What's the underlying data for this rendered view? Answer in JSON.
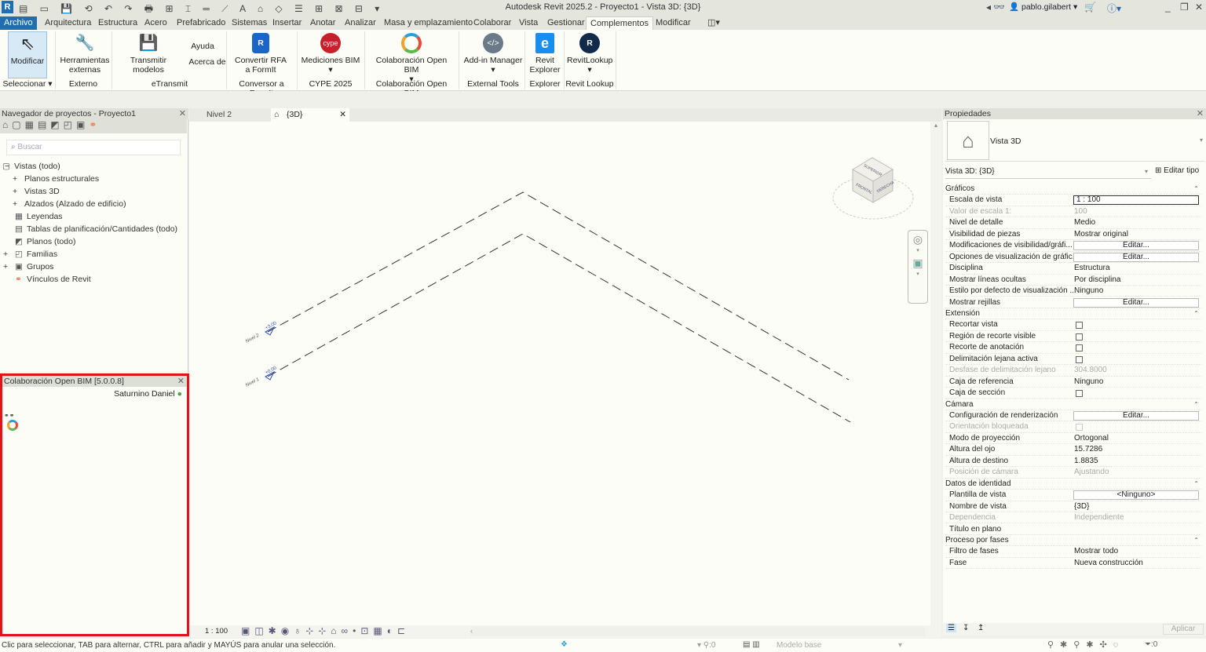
{
  "app": {
    "title": "Autodesk Revit 2025.2 - Proyecto1 - Vista 3D: {3D}",
    "user": "pablo.gilabert"
  },
  "colors": {
    "accent": "#1f6eb3",
    "highlight_border": "#e3131b",
    "ribbon_bg": "#fdfdf7"
  },
  "tabs": [
    "Archivo",
    "Arquitectura",
    "Estructura",
    "Acero",
    "Prefabricado",
    "Sistemas",
    "Insertar",
    "Anotar",
    "Analizar",
    "Masa y emplazamiento",
    "Colaborar",
    "Vista",
    "Gestionar",
    "Complementos",
    "Modificar"
  ],
  "ribbon": {
    "buttons": [
      {
        "label": "Modificar",
        "icon": "cursor-icon"
      },
      {
        "label": "Herramientas externas",
        "icon": "tools-icon"
      },
      {
        "label": "Transmitir modelos",
        "icon": "transmit-icon"
      },
      {
        "label": "Ayuda",
        "icon": ""
      },
      {
        "label": "Acerca de",
        "icon": ""
      },
      {
        "label": "Convertir RFA a FormIt",
        "icon": "rfa-icon"
      },
      {
        "label": "Mediciones BIM",
        "icon": "cype-icon"
      },
      {
        "label": "Colaboración Open BIM",
        "icon": "openbim-icon"
      },
      {
        "label": "Add-in Manager",
        "icon": "addin-icon"
      },
      {
        "label": "Revit Explorer",
        "icon": "explorer-icon"
      },
      {
        "label": "RevitLookup",
        "icon": "lookup-icon"
      }
    ],
    "panels": [
      "Seleccionar ▾",
      "Externo",
      "eTransmit",
      "Conversor a FormIt",
      "CYPE 2025",
      "Colaboración Open BIM",
      "External Tools",
      "Explorer",
      "Revit Lookup"
    ]
  },
  "browser": {
    "title": "Navegador de proyectos - Proyecto1",
    "search_placeholder": "Buscar",
    "items": [
      {
        "label": "Vistas (todo)",
        "toggle": "−"
      },
      {
        "label": "Planos estructurales",
        "toggle": "+"
      },
      {
        "label": "Vistas 3D",
        "toggle": "+"
      },
      {
        "label": "Alzados (Alzado de edificio)",
        "toggle": "+"
      },
      {
        "label": "Leyendas",
        "toggle": ""
      },
      {
        "label": "Tablas de planificación/Cantidades (todo)",
        "toggle": ""
      },
      {
        "label": "Planos (todo)",
        "toggle": ""
      },
      {
        "label": "Familias",
        "toggle": "+"
      },
      {
        "label": "Grupos",
        "toggle": "+"
      },
      {
        "label": "Vínculos de Revit",
        "toggle": ""
      }
    ]
  },
  "openbim": {
    "title": "Colaboración Open BIM [5.0.0.8]",
    "user": "Saturnino Daniel"
  },
  "view": {
    "tabs": [
      "Nivel 2",
      "{3D}"
    ],
    "levels": [
      {
        "name": "Nivel 2",
        "elev": "+3,00"
      },
      {
        "name": "Nivel 1",
        "elev": "+0,00"
      }
    ],
    "viewcube": {
      "top": "SUPERIOR",
      "front": "FRONTAL",
      "right": "DERECHA"
    },
    "scale": "1 : 100"
  },
  "properties": {
    "title": "Propiedades",
    "type": "Vista 3D",
    "instance": "Vista 3D: {3D}",
    "edit_type": "Editar tipo",
    "apply": "Aplicar",
    "rows": [
      {
        "kind": "sec",
        "k": "Gráficos"
      },
      {
        "k": "Escala de vista",
        "v": "1 : 100",
        "kind": "input"
      },
      {
        "k": "Valor de escala    1:",
        "v": "100",
        "kind": "dis"
      },
      {
        "k": "Nivel de detalle",
        "v": "Medio"
      },
      {
        "k": "Visibilidad de piezas",
        "v": "Mostrar original"
      },
      {
        "k": "Modificaciones de visibilidad/gráfi...",
        "v": "Editar...",
        "kind": "btn"
      },
      {
        "k": "Opciones de visualización de gráfic...",
        "v": "Editar...",
        "kind": "btn"
      },
      {
        "k": "Disciplina",
        "v": "Estructura"
      },
      {
        "k": "Mostrar líneas ocultas",
        "v": "Por disciplina"
      },
      {
        "k": "Estilo por defecto de visualización ...",
        "v": "Ninguno"
      },
      {
        "k": "Mostrar rejillas",
        "v": "Editar...",
        "kind": "btn"
      },
      {
        "kind": "sec",
        "k": "Extensión"
      },
      {
        "k": "Recortar vista",
        "kind": "cb"
      },
      {
        "k": "Región de recorte visible",
        "kind": "cb"
      },
      {
        "k": "Recorte de anotación",
        "kind": "cb"
      },
      {
        "k": "Delimitación lejana activa",
        "kind": "cb"
      },
      {
        "k": "Desfase de delimitación lejano",
        "v": "304.8000",
        "kind": "dis"
      },
      {
        "k": "Caja de referencia",
        "v": "Ninguno"
      },
      {
        "k": "Caja de sección",
        "kind": "cb"
      },
      {
        "kind": "sec",
        "k": "Cámara"
      },
      {
        "k": "Configuración de renderización",
        "v": "Editar...",
        "kind": "btn"
      },
      {
        "k": "Orientación bloqueada",
        "kind": "discb"
      },
      {
        "k": "Modo de proyección",
        "v": "Ortogonal"
      },
      {
        "k": "Altura del ojo",
        "v": "15.7286"
      },
      {
        "k": "Altura de destino",
        "v": "1.8835"
      },
      {
        "k": "Posición de cámara",
        "v": "Ajustando",
        "kind": "dis"
      },
      {
        "kind": "sec",
        "k": "Datos de identidad"
      },
      {
        "k": "Plantilla de vista",
        "v": "<Ninguno>",
        "kind": "btn"
      },
      {
        "k": "Nombre de vista",
        "v": "{3D}"
      },
      {
        "k": "Dependencia",
        "v": "Independiente",
        "kind": "dis"
      },
      {
        "k": "Título en plano",
        "v": ""
      },
      {
        "kind": "sec",
        "k": "Proceso por fases"
      },
      {
        "k": "Filtro de fases",
        "v": "Mostrar todo"
      },
      {
        "k": "Fase",
        "v": "Nueva construcción"
      }
    ]
  },
  "status": {
    "message": "Clic para seleccionar, TAB para alternar, CTRL para añadir y MAYÚS para anular una selección.",
    "worksets": ":0",
    "model": "Modelo base",
    "filter": ":0"
  }
}
